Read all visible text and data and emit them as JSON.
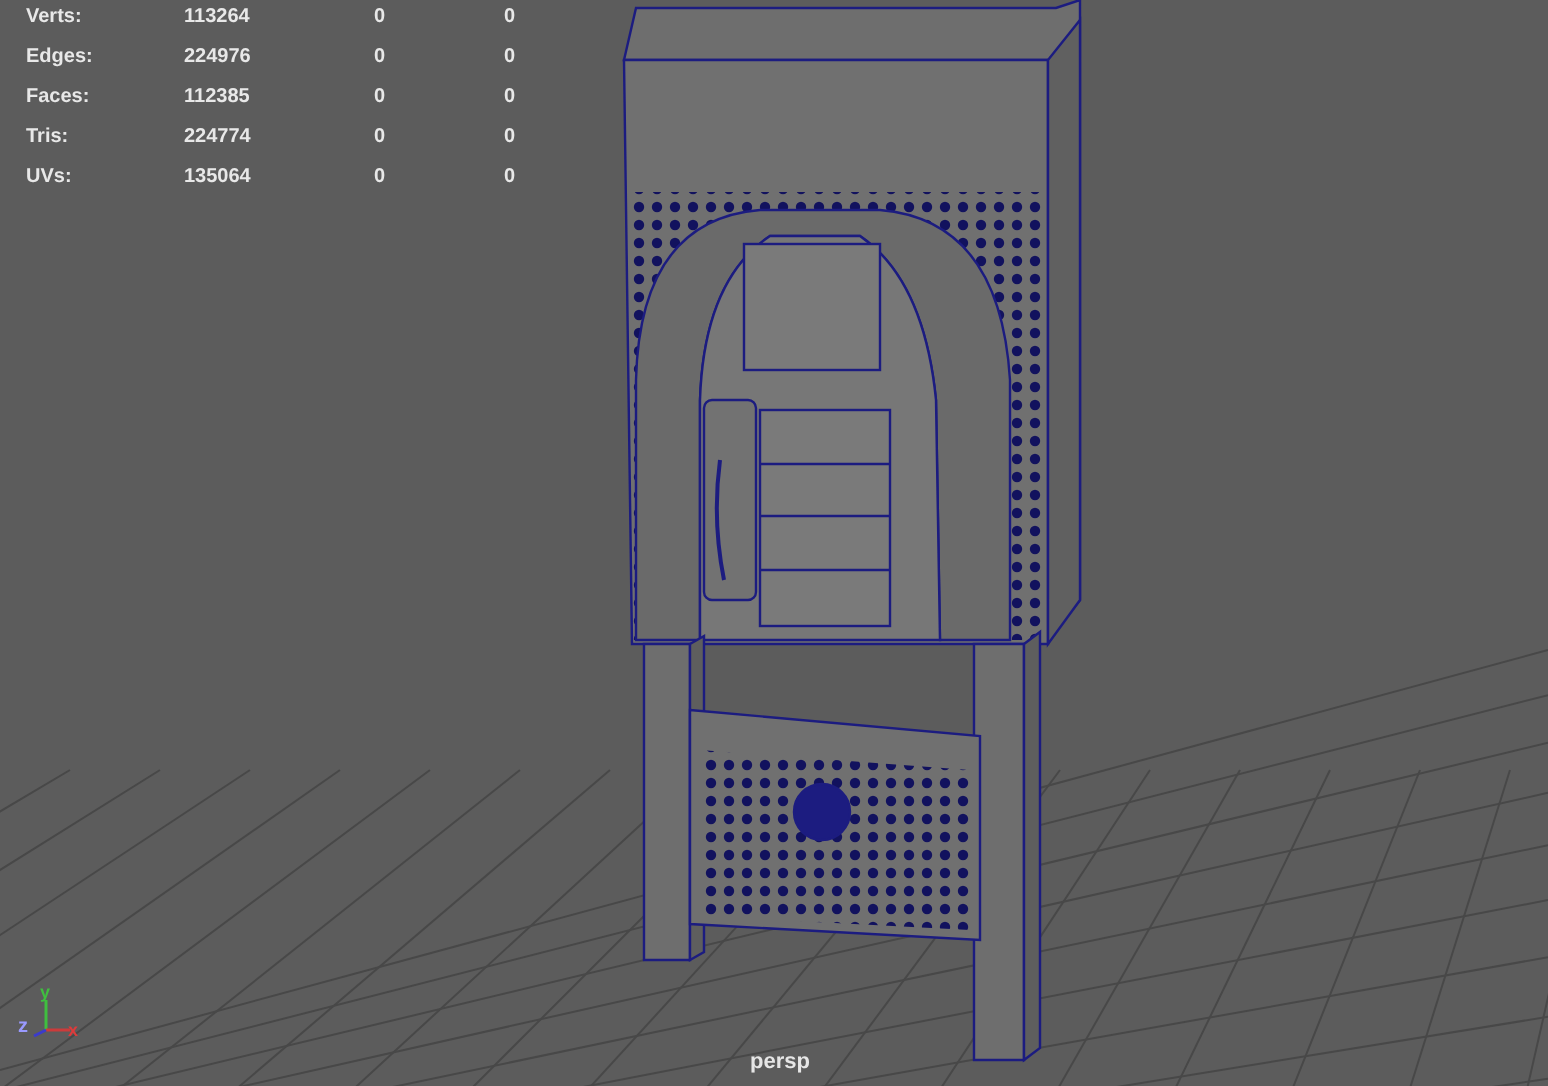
{
  "hud": [
    {
      "label": "Verts:",
      "values": [
        "113264",
        "0",
        "0"
      ]
    },
    {
      "label": "Edges:",
      "values": [
        "224976",
        "0",
        "0"
      ]
    },
    {
      "label": "Faces:",
      "values": [
        "112385",
        "0",
        "0"
      ]
    },
    {
      "label": "Tris:",
      "values": [
        "224774",
        "0",
        "0"
      ]
    },
    {
      "label": "UVs:",
      "values": [
        "135064",
        "0",
        "0"
      ]
    }
  ],
  "axes": {
    "y": "y",
    "z": "z",
    "x": "x"
  },
  "camera": "persp"
}
